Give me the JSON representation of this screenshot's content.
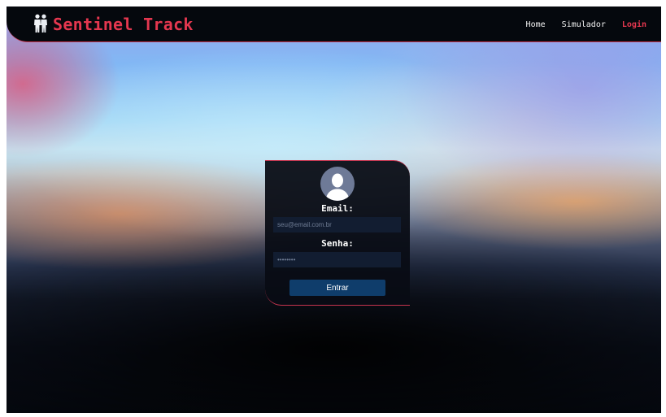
{
  "header": {
    "brand": "Sentinel Track",
    "logo_icon": "people-silhouette-icon"
  },
  "nav": {
    "items": [
      {
        "label": "Home",
        "active": false
      },
      {
        "label": "Simulador",
        "active": false
      },
      {
        "label": "Login",
        "active": true
      }
    ]
  },
  "login": {
    "avatar_icon": "user-avatar-icon",
    "email_label": "Email:",
    "email_placeholder": "seu@email.com.br",
    "email_value": "",
    "password_label": "Senha:",
    "password_placeholder": "••••••••",
    "password_value": "",
    "submit_label": "Entrar"
  },
  "colors": {
    "accent": "#e5374f",
    "navbar_bg": "#05080d",
    "card_bg": "#080c14",
    "input_bg": "#121d31",
    "button_bg": "#0f3d6b"
  }
}
